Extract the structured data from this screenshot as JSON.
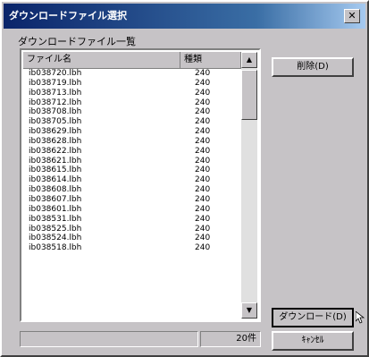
{
  "window": {
    "title": "ダウンロードファイル選択",
    "close_glyph": "✕"
  },
  "group_label": "ダウンロードファイル一覧",
  "list": {
    "columns": [
      "ファイル名",
      "種類"
    ],
    "rows": [
      {
        "name": "ib038720.lbh",
        "count": "240"
      },
      {
        "name": "ib038719.lbh",
        "count": "240"
      },
      {
        "name": "ib038713.lbh",
        "count": "240"
      },
      {
        "name": "ib038712.lbh",
        "count": "240"
      },
      {
        "name": "ib038708.lbh",
        "count": "240"
      },
      {
        "name": "ib038705.lbh",
        "count": "240"
      },
      {
        "name": "ib038629.lbh",
        "count": "240"
      },
      {
        "name": "ib038628.lbh",
        "count": "240"
      },
      {
        "name": "ib038622.lbh",
        "count": "240"
      },
      {
        "name": "ib038621.lbh",
        "count": "240"
      },
      {
        "name": "ib038615.lbh",
        "count": "240"
      },
      {
        "name": "ib038614.lbh",
        "count": "240"
      },
      {
        "name": "ib038608.lbh",
        "count": "240"
      },
      {
        "name": "ib038607.lbh",
        "count": "240"
      },
      {
        "name": "ib038601.lbh",
        "count": "240"
      },
      {
        "name": "ib038531.lbh",
        "count": "240"
      },
      {
        "name": "ib038525.lbh",
        "count": "240"
      },
      {
        "name": "ib038524.lbh",
        "count": "240"
      },
      {
        "name": "ib038518.lbh",
        "count": "240"
      }
    ]
  },
  "buttons": {
    "delete": "削除(D)",
    "download": "ダウンロード(D)",
    "cancel": "ｷｬﾝｾﾙ"
  },
  "status": {
    "count_text": "20件"
  },
  "scroll_glyphs": {
    "up": "▲",
    "down": "▼"
  }
}
